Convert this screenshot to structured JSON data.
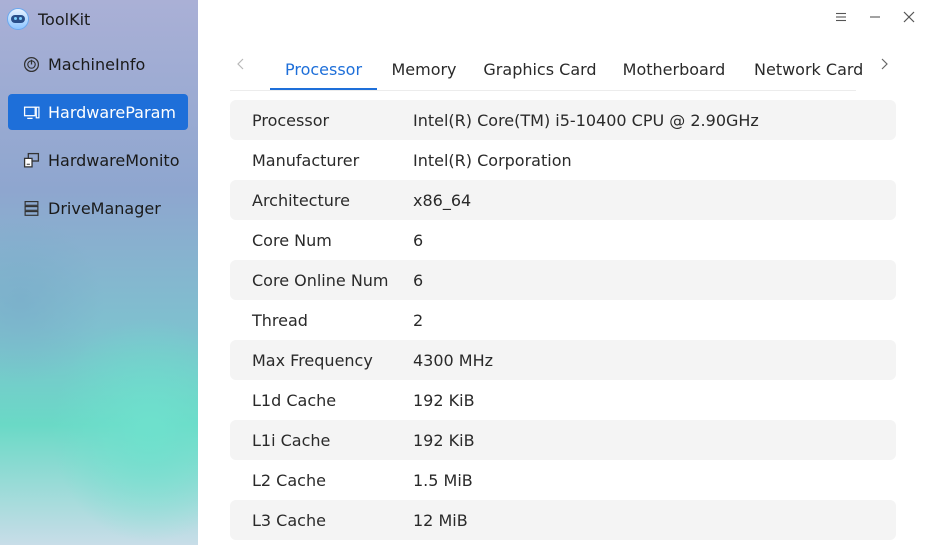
{
  "app": {
    "title": "ToolKit"
  },
  "sidebar": {
    "items": [
      {
        "label": "MachineInfo",
        "icon": "gauge-icon",
        "active": false
      },
      {
        "label": "HardwareParam",
        "icon": "hardware-param-icon",
        "active": true
      },
      {
        "label": "HardwareMonito",
        "icon": "hardware-monitor-icon",
        "active": false
      },
      {
        "label": "DriveManager",
        "icon": "drive-stack-icon",
        "active": false
      }
    ]
  },
  "window_controls": [
    "menu-icon",
    "minimize-icon",
    "close-icon"
  ],
  "tabs": {
    "items": [
      {
        "label": "Processor",
        "active": true
      },
      {
        "label": "Memory",
        "active": false
      },
      {
        "label": "Graphics Card",
        "active": false
      },
      {
        "label": "Motherboard",
        "active": false
      },
      {
        "label": "Network Card",
        "active": false
      }
    ],
    "prev_icon": "chevron-left-icon",
    "next_icon": "chevron-right-icon"
  },
  "table": {
    "rows": [
      {
        "label": "Processor",
        "value": "Intel(R) Core(TM) i5-10400 CPU @ 2.90GHz"
      },
      {
        "label": "Manufacturer",
        "value": "Intel(R) Corporation"
      },
      {
        "label": "Architecture",
        "value": "x86_64"
      },
      {
        "label": "Core Num",
        "value": "6"
      },
      {
        "label": "Core Online Num",
        "value": "6"
      },
      {
        "label": "Thread",
        "value": "2"
      },
      {
        "label": "Max Frequency",
        "value": "4300 MHz"
      },
      {
        "label": "L1d Cache",
        "value": "192 KiB"
      },
      {
        "label": "L1i Cache",
        "value": "192 KiB"
      },
      {
        "label": "L2 Cache",
        "value": "1.5 MiB"
      },
      {
        "label": "L3 Cache",
        "value": "12 MiB"
      }
    ]
  },
  "colors": {
    "accent": "#1e6fd9",
    "row_shade": "#f4f4f4"
  }
}
